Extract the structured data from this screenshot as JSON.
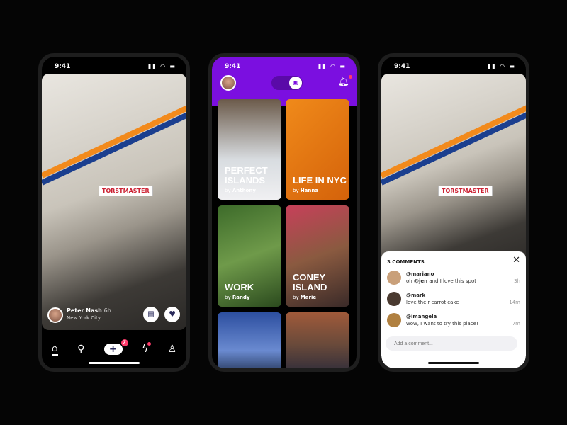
{
  "status": {
    "time": "9:41"
  },
  "feed": {
    "user": "Peter Nash",
    "age": "6h",
    "location": "New York City",
    "sign": "TORSTMASTER",
    "nav": [
      {
        "icon": "home-icon"
      },
      {
        "icon": "search-icon"
      },
      {
        "icon": "plus-icon",
        "badge": "7"
      },
      {
        "icon": "lightning-icon"
      },
      {
        "icon": "profile-icon"
      }
    ]
  },
  "explore": {
    "accent": "#7b0fe0",
    "cards": [
      {
        "title": "PERFECT ISLANDS",
        "by": "by",
        "author": "Anthony"
      },
      {
        "title": "LIFE IN NYC",
        "by": "by",
        "author": "Hanna"
      },
      {
        "title": "WORK",
        "by": "by",
        "author": "Randy"
      },
      {
        "title": "CONEY ISLAND",
        "by": "by",
        "author": "Marie"
      }
    ]
  },
  "comments": {
    "title": "3 COMMENTS",
    "placeholder": "Add a comment...",
    "items": [
      {
        "user": "@mariano",
        "pre": "oh ",
        "mention": "@jen",
        "text": " and I love this spot",
        "time": "3h"
      },
      {
        "user": "@mark",
        "pre": "",
        "mention": "",
        "text": "love their carrot cake",
        "time": "14m"
      },
      {
        "user": "@imangela",
        "pre": "",
        "mention": "",
        "text": "wow, I want to try this place!",
        "time": "7m"
      }
    ]
  }
}
